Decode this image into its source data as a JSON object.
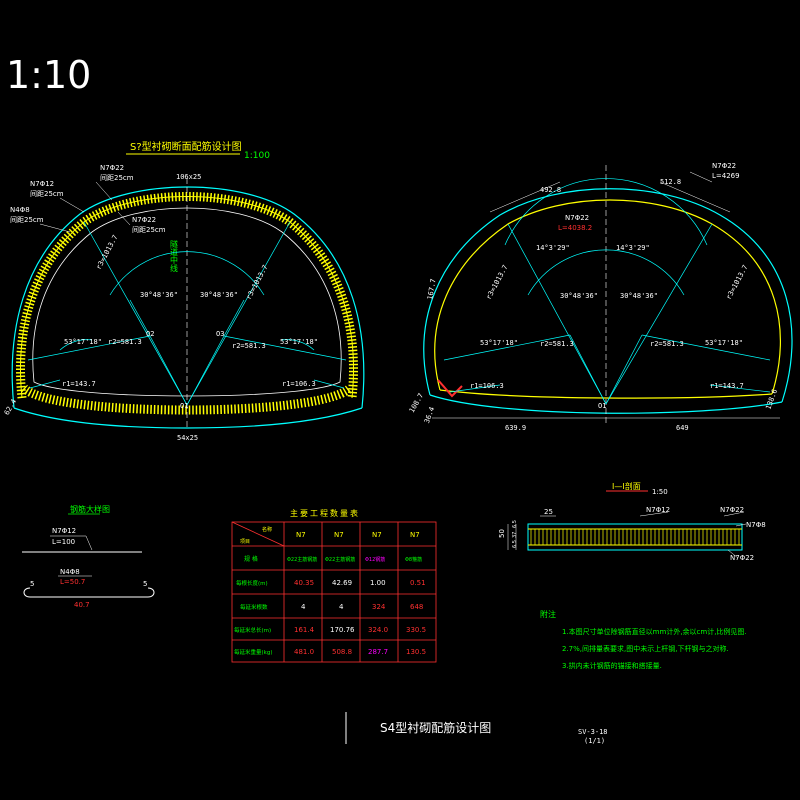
{
  "scale_label": "1:10",
  "left_section": {
    "title": "S?型衬砌断面配筋设计图",
    "scale": "1:100",
    "top_label": "106x25",
    "bottom_label": "54x25",
    "center_text": "隧道中线",
    "bar_labels": [
      {
        "name": "N7Φ22",
        "spacing": "间距25cm"
      },
      {
        "name": "N7Φ12",
        "spacing": "间距25cm"
      },
      {
        "name": "N7Φ22",
        "spacing": "间距25cm"
      },
      {
        "name": "N4Φ8",
        "spacing": "间距25cm"
      }
    ],
    "angles": [
      "30°48'36\"",
      "30°48'36\"",
      "53°17'18\"",
      "53°17'18\""
    ],
    "radii": [
      "r3=1013.7",
      "r3=1013.7",
      "r2=581.3",
      "r2=581.3",
      "r1=143.7",
      "r1=106.3"
    ],
    "points": [
      "O1",
      "O2",
      "O3",
      "O2"
    ],
    "corner_left": "62.4"
  },
  "right_section": {
    "bar_top": "N7Φ22",
    "bar_top_len": "L=4269",
    "bar_mid": "N7Φ22",
    "bar_mid_len": "L=4038.2",
    "dims": [
      "492.8",
      "512.8",
      "14°3'29\"",
      "14°3'29\"",
      "30°48'36\"",
      "30°48'36\"",
      "53°17'18\"",
      "53°17'18\""
    ],
    "radii": [
      "r3=1013.7",
      "r3=1013.7",
      "r1=106.3",
      "r1=143.7",
      "r2=581.3",
      "r2=581.3",
      "r2=1013.7"
    ],
    "bottom_left": "639.9",
    "bottom_right": "649",
    "side_left": "167.7",
    "side_right": "138.6",
    "corner_a": "108.7",
    "corner_b": "36.4",
    "point": "O1"
  },
  "bar_detail": {
    "title": "钢筋大样图",
    "n7": "N7Φ12",
    "n7_len": "L=100",
    "n4": "N4Φ8",
    "n4_len": "L=50.7",
    "hook_left": "5",
    "hook_right": "5",
    "total": "40.7"
  },
  "quantity_table": {
    "title": "主要工程数量表",
    "header_corner_top": "名称",
    "header_corner_bottom": "项目",
    "columns": [
      "N7",
      "N7",
      "N7",
      "N7"
    ],
    "row_labels": [
      "规 格",
      "每根长度(m)",
      "每延米根数",
      "每延米总长(m)",
      "每延米重量(kg)"
    ],
    "spec": [
      "Φ22主筋钢筋",
      "Φ22主筋钢筋",
      "Φ12钢筋",
      "Φ8箍筋"
    ],
    "rows": [
      [
        "40.35",
        "42.69",
        "1.00",
        "0.51"
      ],
      [
        "4",
        "4",
        "324",
        "648"
      ],
      [
        "161.4",
        "170.76",
        "324.0",
        "330.5"
      ],
      [
        "481.0",
        "508.8",
        "287.7",
        "130.5"
      ]
    ]
  },
  "section_detail": {
    "title": "I—I剖面",
    "scale": "1:50",
    "labels": [
      "N7Φ12",
      "N7Φ22",
      "N7Φ8",
      "N7Φ22"
    ],
    "dim_top": "25",
    "dim_side": "50",
    "dim_small": [
      "6.5",
      "37",
      "6.5"
    ]
  },
  "notes": {
    "title": "附注",
    "items": [
      "1.本图尺寸单位除钢筋直径以mm计外,余以cm计,比例见图.",
      "2.7%,间排量表要求,图中未示上杆钢,下杆钢与之对称.",
      "3.拱内未计钢筋的锚接和搭接量."
    ]
  },
  "footer": {
    "title": "S4型衬砌配筋设计图",
    "code": "SV-3-18",
    "page": "(1/1)"
  },
  "colors": {
    "background": "#000000",
    "outline": "#00ffff",
    "rebar": "#ffff00",
    "text": "#00ff00",
    "dim": "#ffffff",
    "red": "#ff3030",
    "magenta": "#ff00ff",
    "grid": "#ff3030"
  }
}
